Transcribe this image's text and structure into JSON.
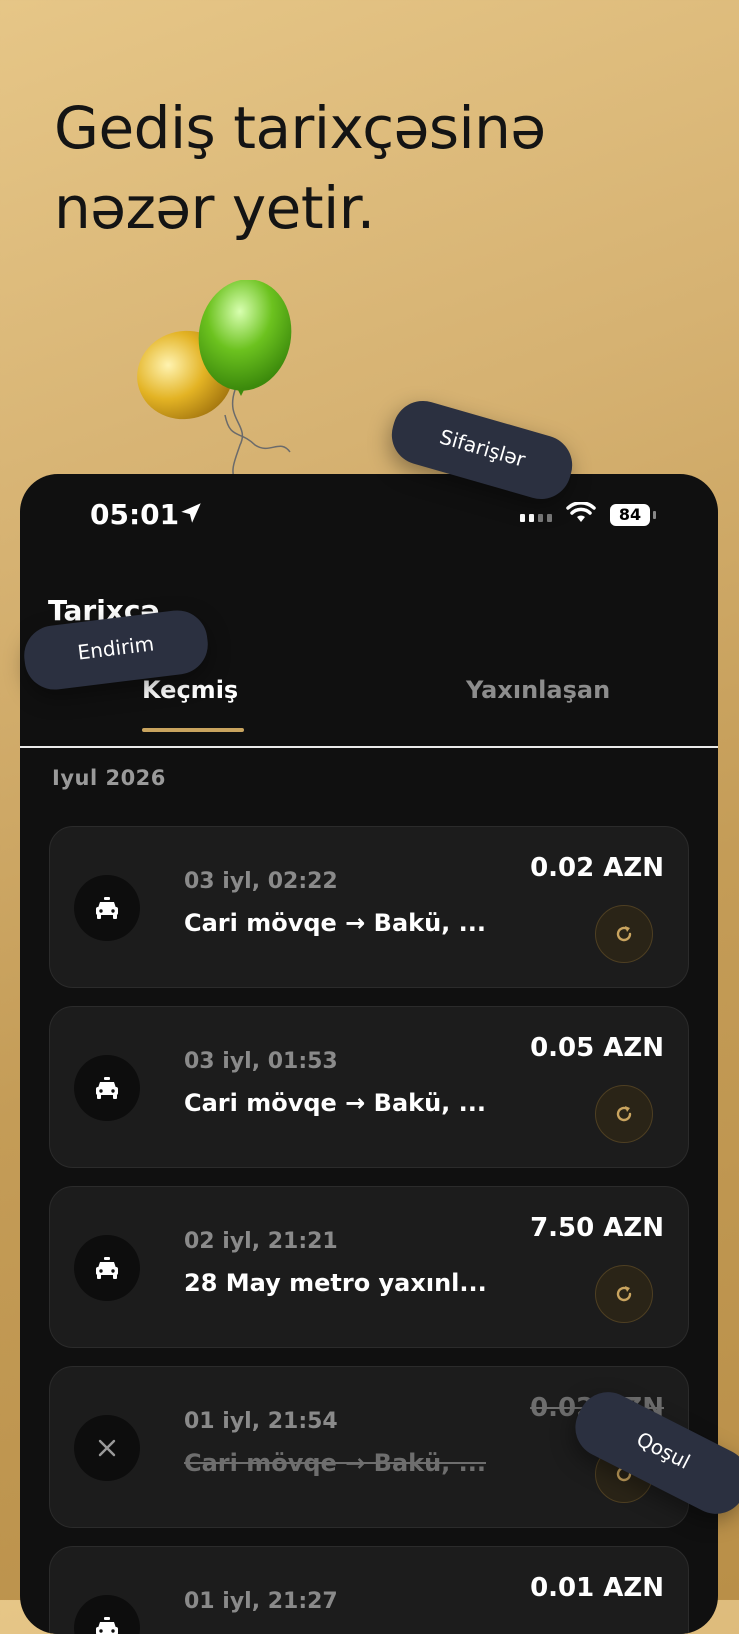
{
  "headline": [
    "Gediş tarixçəsinə",
    "nəzər yetir."
  ],
  "status_bar": {
    "time": "05:01",
    "battery": "84"
  },
  "page_title": "Tarixcə",
  "tabs": [
    {
      "label": "Keçmiş",
      "active": true
    },
    {
      "label": "Yaxınlaşan",
      "active": false
    }
  ],
  "month_header": "Iyul 2026",
  "rides": [
    {
      "date": "03 iyl, 02:22",
      "route": "Cari mövqe → Bakü, ...",
      "price": "0.02 AZN",
      "status": "completed"
    },
    {
      "date": "03 iyl, 01:53",
      "route": "Cari mövqe → Bakü, ...",
      "price": "0.05 AZN",
      "status": "completed"
    },
    {
      "date": "02 iyl, 21:21",
      "route": "28 May metro yaxınl...",
      "price": "7.50 AZN",
      "status": "completed"
    },
    {
      "date": "01 iyl, 21:54",
      "route": "Cari mövqe → Bakü, ...",
      "price": "0.02 AZN",
      "status": "cancelled"
    },
    {
      "date": "01 iyl, 21:27",
      "route": "",
      "price": "0.01 AZN",
      "status": "completed"
    }
  ],
  "floating_pills": {
    "orders": "Sifarişlər",
    "discount": "Endirim",
    "join": "Qoşul"
  },
  "colors": {
    "accent": "#c9a45f",
    "background": "#101010",
    "card": "#1c1c1c",
    "pill": "#2b3040"
  }
}
